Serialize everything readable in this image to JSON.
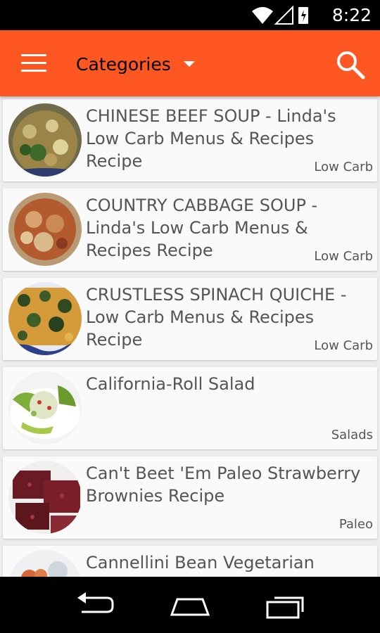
{
  "status_bar": {
    "time": "8:22"
  },
  "app_bar": {
    "title": "Categories"
  },
  "recipes": [
    {
      "title": "CHINESE BEEF SOUP - Linda's Low Carb Menus & Recipes Recipe",
      "category": "Low Carb"
    },
    {
      "title": "COUNTRY CABBAGE SOUP - Linda's Low Carb Menus & Recipes Recipe",
      "category": "Low Carb"
    },
    {
      "title": "CRUSTLESS SPINACH QUICHE - Low Carb Menus & Recipes Recipe",
      "category": "Low Carb"
    },
    {
      "title": "California-Roll Salad",
      "category": "Salads"
    },
    {
      "title": "Can't Beet 'Em Paleo Strawberry Brownies Recipe",
      "category": "Paleo"
    },
    {
      "title": "Cannellini Bean Vegetarian",
      "category": ""
    }
  ]
}
